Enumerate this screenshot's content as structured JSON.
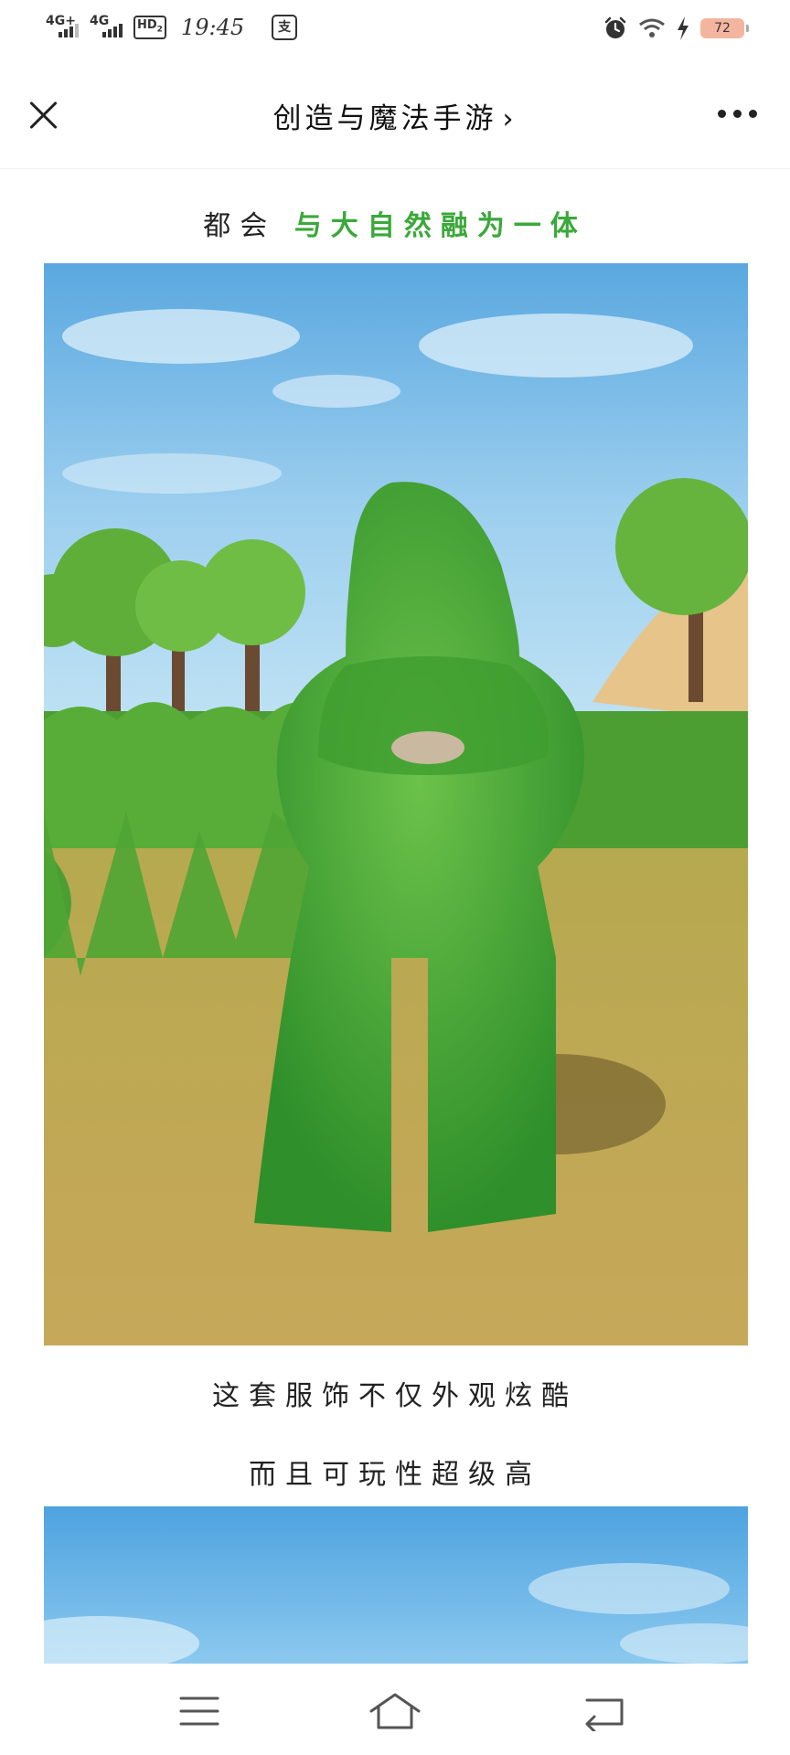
{
  "status_bar": {
    "signal_1_label": "4G+",
    "signal_2_label": "4G",
    "hd_label": "HD",
    "hd_sub": "2",
    "time": "19:45",
    "alipay_icon_label": "支",
    "battery_level": "72",
    "icons": [
      "alarm-icon",
      "wifi-icon",
      "charging-icon",
      "battery-icon"
    ]
  },
  "nav": {
    "title": "创造与魔法手游",
    "chevron": "›",
    "icons": [
      "close-icon",
      "more-icon"
    ]
  },
  "article": {
    "caption_1_prefix": "都会",
    "caption_1_highlight": "与大自然融为一体",
    "caption_2": "这套服饰不仅外观炫酷",
    "caption_3": "而且可玩性超级高",
    "images": [
      "grass-suit-character-image",
      "sky-image"
    ]
  },
  "colors": {
    "highlight_green": "#3aa83a",
    "battery_fill": "#f4b59e"
  },
  "system_nav": {
    "icons": [
      "menu-icon",
      "home-icon",
      "back-icon"
    ]
  }
}
